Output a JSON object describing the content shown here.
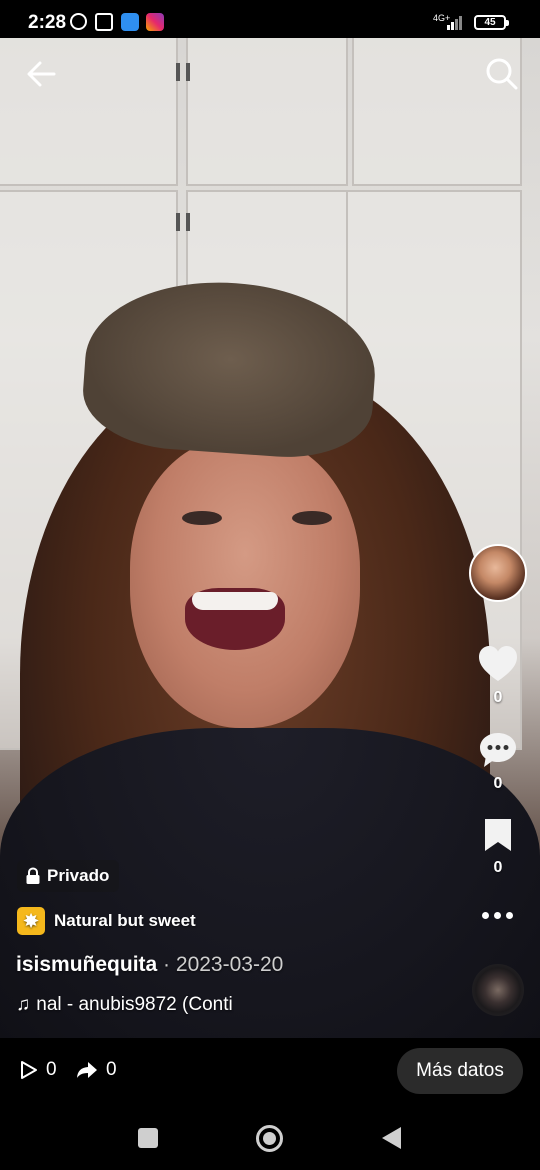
{
  "status_bar": {
    "time": "2:28",
    "network": "4G+",
    "battery": "45",
    "icons": [
      "alarm-icon",
      "nfc-icon",
      "messenger-icon",
      "instagram-icon"
    ]
  },
  "top_bar": {
    "back_icon": "arrow-left-icon",
    "search_icon": "search-icon"
  },
  "actions": {
    "likes": "0",
    "comments": "0",
    "saves": "0"
  },
  "post": {
    "privacy_label": "Privado",
    "effect_label": "Natural but sweet",
    "author": "isismuñequita",
    "separator": "·",
    "date": "2023-03-20",
    "music": "nal - anubis9872 (Conti"
  },
  "stats": {
    "plays": "0",
    "shares": "0",
    "more_data_label": "Más datos"
  },
  "colors": {
    "effect_badge": "#f5b81c",
    "more_data_bg": "#2b2b2b"
  }
}
